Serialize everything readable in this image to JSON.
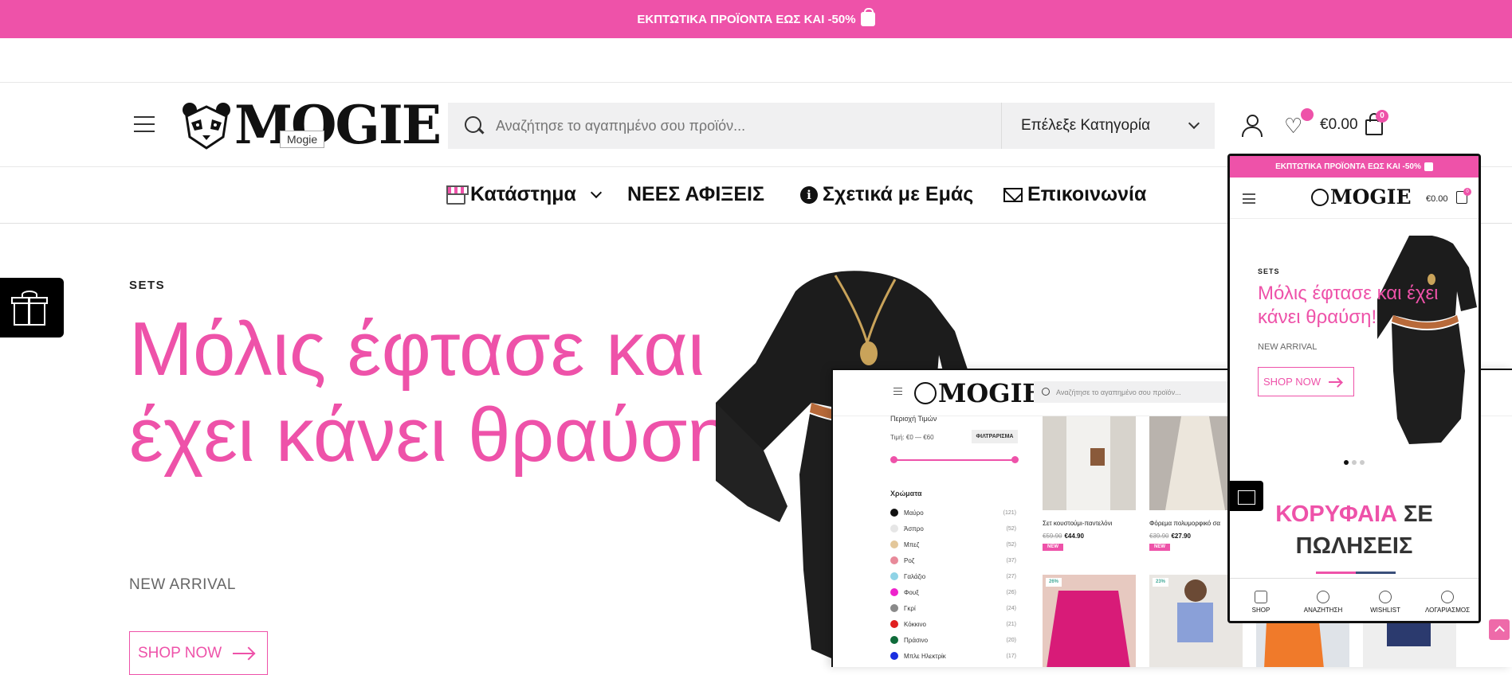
{
  "promo": {
    "text": "ΕΚΠΤΩΤΙΚΑ ΠΡΟΪΟΝΤΑ ΕΩΣ ΚΑΙ -50%",
    "icon": "shopping-bag-icon"
  },
  "header": {
    "logo_text": "MOGIE",
    "logo_tooltip": "Mogie",
    "search_placeholder": "Αναζήτησε το αγαπημένο σου προϊόν...",
    "category_select": "Επέλεξε Κατηγορία",
    "cart_price": "€0.00",
    "cart_count": "0"
  },
  "nav": {
    "items": [
      {
        "label": "Κατάστημα",
        "icon": "store-icon"
      },
      {
        "label": "ΝΕΕΣ ΑΦΙΞΕΙΣ"
      },
      {
        "label": "Σχετικά με Εμάς",
        "icon": "info-icon"
      },
      {
        "label": "Επικοινωνία",
        "icon": "mail-icon"
      }
    ]
  },
  "hero": {
    "tag": "SETS",
    "title": "Μόλις έφτασε και έχει κάνει θραύση!",
    "subtitle": "NEW ARRIVAL",
    "button": "SHOP NOW"
  },
  "desktop_mock": {
    "logo_text": "MOGIE",
    "search_placeholder": "Αναζήτησε το αγαπημένο σου προϊόν...",
    "filter_title": "Περιοχή Τιμών",
    "price_range": "Τιμή: €0 — €60",
    "filter_button": "ΦΙΛΤΡΑΡΙΣΜΑ",
    "colors_title": "Χρώματα",
    "colors": [
      {
        "name": "Μαύρο",
        "count": "(121)",
        "hex": "#111111"
      },
      {
        "name": "Άσπρο",
        "count": "(52)",
        "hex": "#e6e6e6"
      },
      {
        "name": "Μπεζ",
        "count": "(52)",
        "hex": "#e3c79a"
      },
      {
        "name": "Ροζ",
        "count": "(37)",
        "hex": "#e88a9a"
      },
      {
        "name": "Γαλάζιο",
        "count": "(27)",
        "hex": "#8fd3e6"
      },
      {
        "name": "Φουξ",
        "count": "(26)",
        "hex": "#ee22cc"
      },
      {
        "name": "Γκρί",
        "count": "(24)",
        "hex": "#8a8a8a"
      },
      {
        "name": "Κόκκινο",
        "count": "(21)",
        "hex": "#e02020"
      },
      {
        "name": "Πράσινο",
        "count": "(20)",
        "hex": "#0f6b3a"
      },
      {
        "name": "Μπλε Ηλεκτρίκ",
        "count": "(17)",
        "hex": "#1a2fe0"
      }
    ],
    "products": [
      {
        "name": "Σετ κουστούμι-παντελόνι",
        "old_price": "€59.90",
        "price": "€44.90",
        "badge": "NEW"
      },
      {
        "name": "Φόρεμα πολυμορφικό σα",
        "old_price": "€39.90",
        "price": "€27.90",
        "badge": "NEW"
      }
    ],
    "discounts": [
      "26%",
      "23%"
    ]
  },
  "phone": {
    "promo": "ΕΚΠΤΩΤΙΚΑ ΠΡΟΪΟΝΤΑ ΕΩΣ ΚΑΙ -50%",
    "logo_text": "MOGIE",
    "price": "€0.00",
    "cart_count": "0",
    "tag": "SETS",
    "title": "Μόλις έφτασε και έχει κάνει θραύση!",
    "subtitle": "NEW ARRIVAL",
    "button": "SHOP NOW",
    "best_pink": "ΚΟΡΥΦΑΙΑ",
    "best_dark_1": "ΣΕ",
    "best_dark_2": "ΠΩΛΗΣΕΙΣ",
    "bottom_nav": [
      "SHOP",
      "ΑΝΑΖΗΤΗΣΗ",
      "WISHLIST",
      "ΛΟΓΑΡΙΑΣΜΟΣ"
    ]
  },
  "colors": {
    "accent": "#ee52a9",
    "dark": "#111111"
  }
}
